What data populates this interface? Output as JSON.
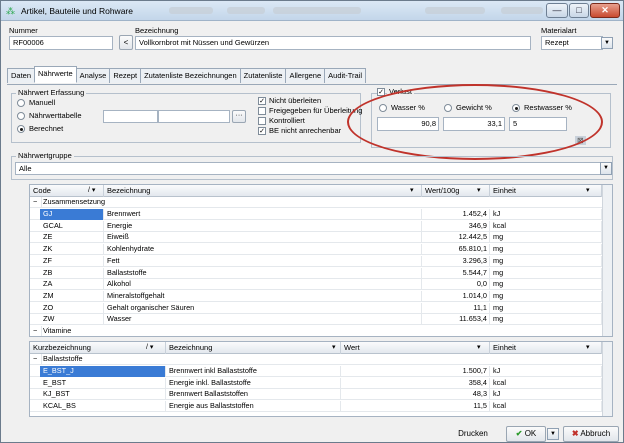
{
  "window": {
    "title": "Artikel, Bauteile und Rohware",
    "minimize": "—",
    "maximize": "□",
    "close": "✕"
  },
  "header": {
    "nummer_label": "Nummer",
    "nummer_value": "RF00006",
    "bezeichnung_label": "Bezeichnung",
    "bezeichnung_value": "Vollkornbrot mit Nüssen und Gewürzen",
    "materialart_label": "Materialart",
    "materialart_value": "Rezept",
    "back_symbol": "<"
  },
  "tabs": [
    "Daten",
    "Nährwerte",
    "Analyse",
    "Rezept",
    "Zutatenliste Bezeichnungen",
    "Zutatenliste",
    "Allergene",
    "Audit-Trail"
  ],
  "erfassung": {
    "label": "Nährwert Erfassung",
    "manuell": "Manuell",
    "naehrwerttabelle": "Nährwerttabelle",
    "berechnet": "Berechnet",
    "ellipsis": "···",
    "checks": [
      {
        "label": "Nicht überleiten",
        "checked": true
      },
      {
        "label": "Freigegeben für Überleitung",
        "checked": false
      },
      {
        "label": "Kontrolliert",
        "checked": false
      },
      {
        "label": "BE nicht anrechenbar",
        "checked": true
      }
    ]
  },
  "verlust": {
    "label": "Verlust",
    "wasser_label": "Wasser %",
    "gewicht_label": "Gewicht %",
    "restwasser_label": "Restwasser %",
    "wasser_value": "90,8",
    "gewicht_value": "33,1",
    "restwasser_value": "5"
  },
  "naehrwertgruppe": {
    "label": "Nährwertgruppe",
    "value": "Alle"
  },
  "grid1": {
    "headers": [
      "Code",
      "Bezeichnung",
      "Wert/100g",
      "Einheit"
    ],
    "group1": "Zusammensetzung",
    "rows": [
      [
        "GJ",
        "Brennwert",
        "1.452,4",
        "kJ"
      ],
      [
        "GCAL",
        "Energie",
        "346,9",
        "kcal"
      ],
      [
        "ZE",
        "Eiweiß",
        "12.442,5",
        "mg"
      ],
      [
        "ZK",
        "Kohlenhydrate",
        "65.810,1",
        "mg"
      ],
      [
        "ZF",
        "Fett",
        "3.296,3",
        "mg"
      ],
      [
        "ZB",
        "Ballaststoffe",
        "5.544,7",
        "mg"
      ],
      [
        "ZA",
        "Alkohol",
        "0,0",
        "mg"
      ],
      [
        "ZM",
        "Mineralstoffgehalt",
        "1.014,0",
        "mg"
      ],
      [
        "ZO",
        "Gehalt organischer Säuren",
        "11,1",
        "mg"
      ],
      [
        "ZW",
        "Wasser",
        "11.653,4",
        "mg"
      ]
    ],
    "group2": "Vitamine"
  },
  "grid2": {
    "headers": [
      "Kurzbezeichnung",
      "Bezeichnung",
      "Wert",
      "Einheit"
    ],
    "group1": "Ballaststoffe",
    "rows": [
      [
        "E_BST_J",
        "Brennwert inkl Ballaststoffe",
        "1.500,7",
        "kJ"
      ],
      [
        "E_BST",
        "Energie inkl. Ballaststoffe",
        "358,4",
        "kcal"
      ],
      [
        "KJ_BST",
        "Brennwert Ballaststoffen",
        "48,3",
        "kJ"
      ],
      [
        "KCAL_BS",
        "Energie aus Ballaststoffen",
        "11,5",
        "kcal"
      ]
    ]
  },
  "footer": {
    "drucken": "Drucken",
    "ok": "OK",
    "abbruch": "Abbruch"
  }
}
